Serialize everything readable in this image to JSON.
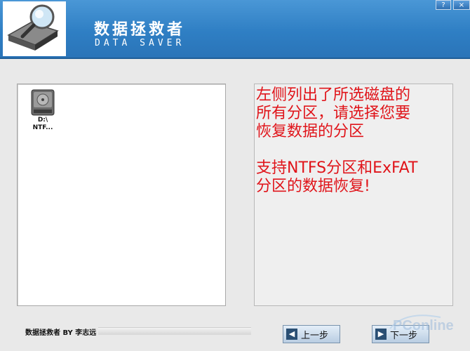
{
  "header": {
    "title": "数据拯救者",
    "subtitle": "DATA SAVER",
    "help_label": "?",
    "close_label": "×"
  },
  "partitions": [
    {
      "drive": "D:\\",
      "fs": "NTF..."
    }
  ],
  "info": {
    "text": "左侧列出了所选磁盘的\n所有分区，请选择您要\n恢复数据的分区\n\n支持NTFS分区和ExFAT\n分区的数据恢复!"
  },
  "footer": {
    "status": "数据拯救者 BY 李志远",
    "prev_label": "上一步",
    "next_label": "下一步",
    "progress": 0
  },
  "watermark": {
    "text": "PConline"
  },
  "colors": {
    "header": "#2f7fc4",
    "info_text": "#e0141a"
  }
}
